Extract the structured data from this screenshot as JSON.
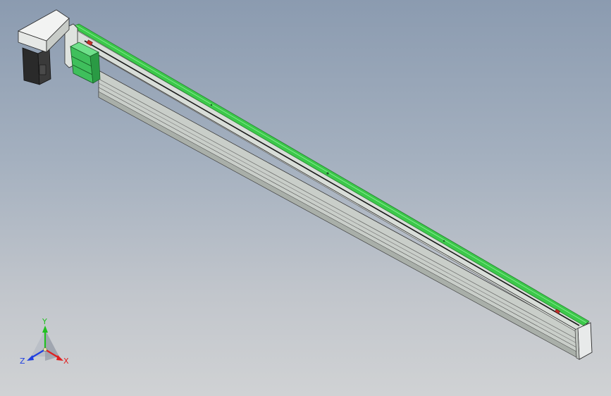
{
  "viewport": {
    "background_top": "#8b9bb0",
    "background_bottom": "#d0d2d4"
  },
  "model": {
    "rail_color": "#3cc84a",
    "profile_color": "#dfe3df",
    "motor_color": "#2a2a2a",
    "carriage_color": "#3fbf5c",
    "end_cap_color": "#e8eaea"
  },
  "triad": {
    "x_label": "X",
    "y_label": "Y",
    "z_label": "Z",
    "x_color": "#e02020",
    "y_color": "#20c020",
    "z_color": "#2040e0"
  }
}
